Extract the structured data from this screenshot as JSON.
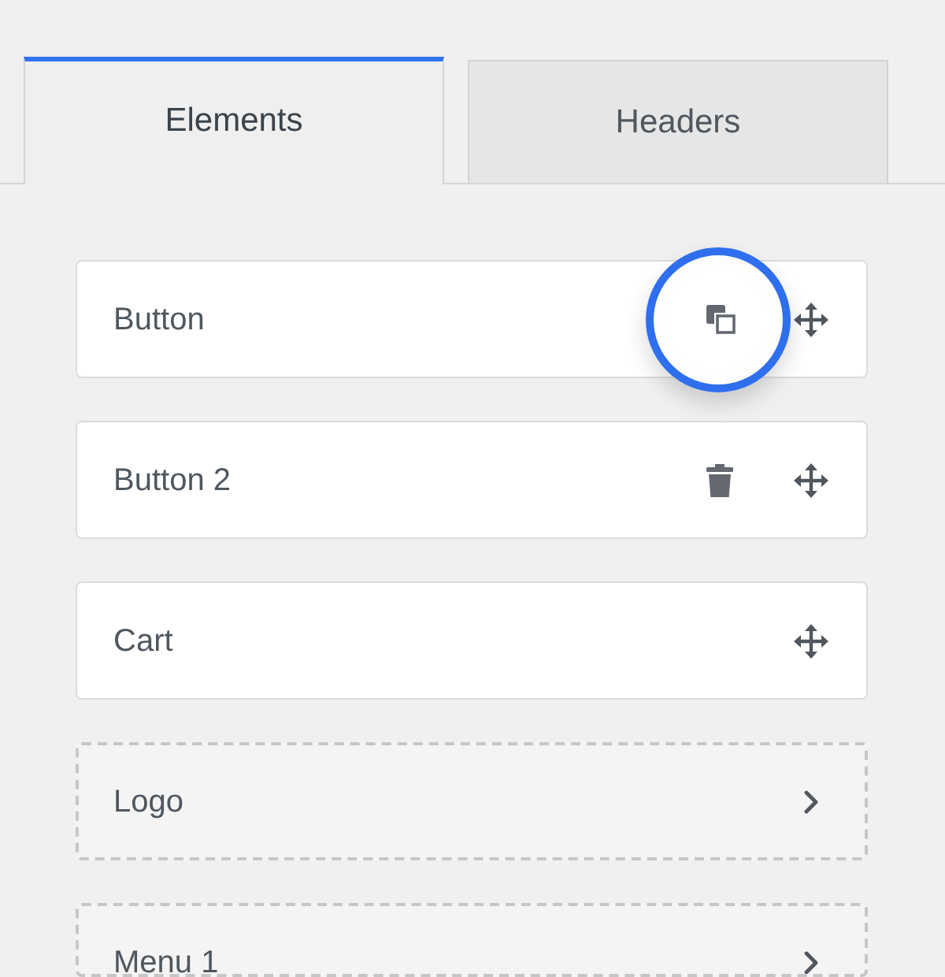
{
  "tabs": [
    {
      "label": "Elements",
      "selected": true
    },
    {
      "label": "Headers",
      "selected": false
    }
  ],
  "items": [
    {
      "label": "Button",
      "kind": "placed",
      "actions": [
        {
          "kind": "duplicate",
          "highlighted": true
        },
        {
          "kind": "move",
          "highlighted": false
        }
      ]
    },
    {
      "label": "Button 2",
      "kind": "placed",
      "actions": [
        {
          "kind": "delete",
          "highlighted": false
        },
        {
          "kind": "move",
          "highlighted": false
        }
      ]
    },
    {
      "label": "Cart",
      "kind": "placed",
      "actions": [
        {
          "kind": "move",
          "highlighted": false
        }
      ]
    },
    {
      "label": "Logo",
      "kind": "available",
      "actions": [
        {
          "kind": "expand",
          "highlighted": false
        }
      ]
    },
    {
      "label": "Menu 1",
      "kind": "available",
      "actions": [
        {
          "kind": "expand",
          "highlighted": false
        }
      ]
    }
  ]
}
